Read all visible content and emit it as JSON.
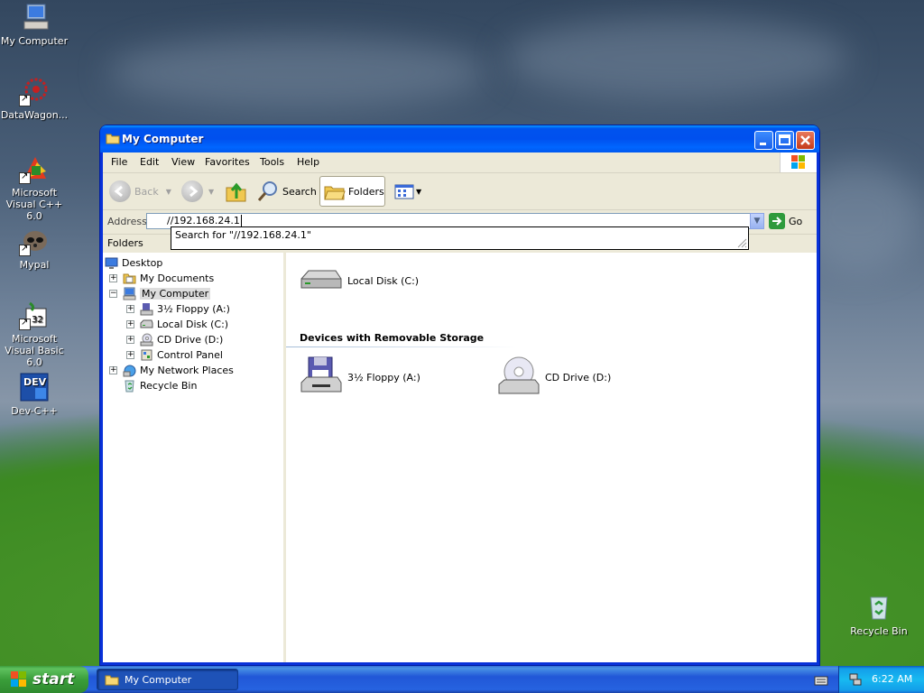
{
  "desktop": {
    "icons": [
      {
        "label": "My Computer"
      },
      {
        "label": "DataWagon..."
      },
      {
        "label": "Microsoft Visual C++ 6.0"
      },
      {
        "label": "Mypal"
      },
      {
        "label": "Microsoft Visual Basic 6.0"
      },
      {
        "label": "Dev-C++"
      },
      {
        "label": "Recycle Bin"
      }
    ]
  },
  "window": {
    "title": "My Computer",
    "menu": [
      "File",
      "Edit",
      "View",
      "Favorites",
      "Tools",
      "Help"
    ],
    "toolbar": {
      "back": "Back",
      "search": "Search",
      "folders": "Folders"
    },
    "address": {
      "label": "Address",
      "value": "//192.168.24.1",
      "go": "Go",
      "suggestion": "Search for \"//192.168.24.1\""
    },
    "folders_header": "Folders",
    "tree": [
      {
        "label": "Desktop",
        "icon": "desktop-icon"
      },
      {
        "label": "My Documents",
        "icon": "folder-icon"
      },
      {
        "label": "My Computer",
        "icon": "computer-icon"
      },
      {
        "label": "3½ Floppy (A:)",
        "icon": "floppy-icon"
      },
      {
        "label": "Local Disk (C:)",
        "icon": "hard-disk-icon"
      },
      {
        "label": "CD Drive (D:)",
        "icon": "cd-drive-icon"
      },
      {
        "label": "Control Panel",
        "icon": "control-panel-icon"
      },
      {
        "label": "My Network Places",
        "icon": "network-icon"
      },
      {
        "label": "Recycle Bin",
        "icon": "recycle-bin-icon"
      }
    ],
    "content": {
      "hard_disk": "Local Disk (C:)",
      "group_title": "Devices with Removable Storage",
      "floppy": "3½ Floppy (A:)",
      "cd": "CD Drive (D:)"
    }
  },
  "taskbar": {
    "start": "start",
    "task": "My Computer",
    "clock": "6:22 AM"
  },
  "colors": {
    "titlebar": "#0054e3",
    "taskbar": "#245edb",
    "start": "#3c9b3c"
  }
}
